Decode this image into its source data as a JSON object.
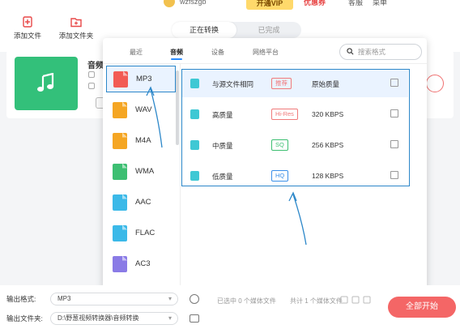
{
  "toolbar": {
    "add_file": "添加文件",
    "add_folder": "添加文件夹"
  },
  "user": {
    "name": "wzfszgb",
    "vip_button": "开通VIP",
    "coupon": "优惠券",
    "service": "客服",
    "menu": "菜单"
  },
  "main_tabs": [
    "正在转换",
    "已完成"
  ],
  "file_card": {
    "name": "音频"
  },
  "popup": {
    "categories": [
      "最近",
      "音频",
      "设备",
      "网络平台"
    ],
    "active_category": "音频",
    "search_placeholder": "搜索格式",
    "formats": [
      {
        "label": "MP3",
        "color": "#f25c54"
      },
      {
        "label": "WAV",
        "color": "#f5a623"
      },
      {
        "label": "M4A",
        "color": "#f5a623"
      },
      {
        "label": "WMA",
        "color": "#3dbf72"
      },
      {
        "label": "AAC",
        "color": "#3bb9e8"
      },
      {
        "label": "FLAC",
        "color": "#3bb9e8"
      },
      {
        "label": "AC3",
        "color": "#8a7be6"
      }
    ],
    "selected_format": "MP3",
    "qualities": [
      {
        "name": "与源文件相同",
        "tag": "推荐",
        "tag_color": "#f07a7a",
        "bitrate": "原始质量"
      },
      {
        "name": "高质量",
        "tag": "Hi-Res",
        "tag_color": "#f07a7a",
        "bitrate": "320 KBPS"
      },
      {
        "name": "中质量",
        "tag": "SQ",
        "tag_color": "#3dbf72",
        "bitrate": "256 KBPS"
      },
      {
        "name": "低质量",
        "tag": "HQ",
        "tag_color": "#3b8fe8",
        "bitrate": "128 KBPS"
      }
    ]
  },
  "bottom": {
    "output_format_label": "输出格式:",
    "output_format_value": "MP3",
    "output_folder_label": "输出文件夹:",
    "output_folder_value": "D:\\野葱视频转换器\\音频转换",
    "selected_status": "已选中 0 个媒体文件",
    "total_status": "共计 1 个媒体文件",
    "start_button": "全部开始"
  }
}
